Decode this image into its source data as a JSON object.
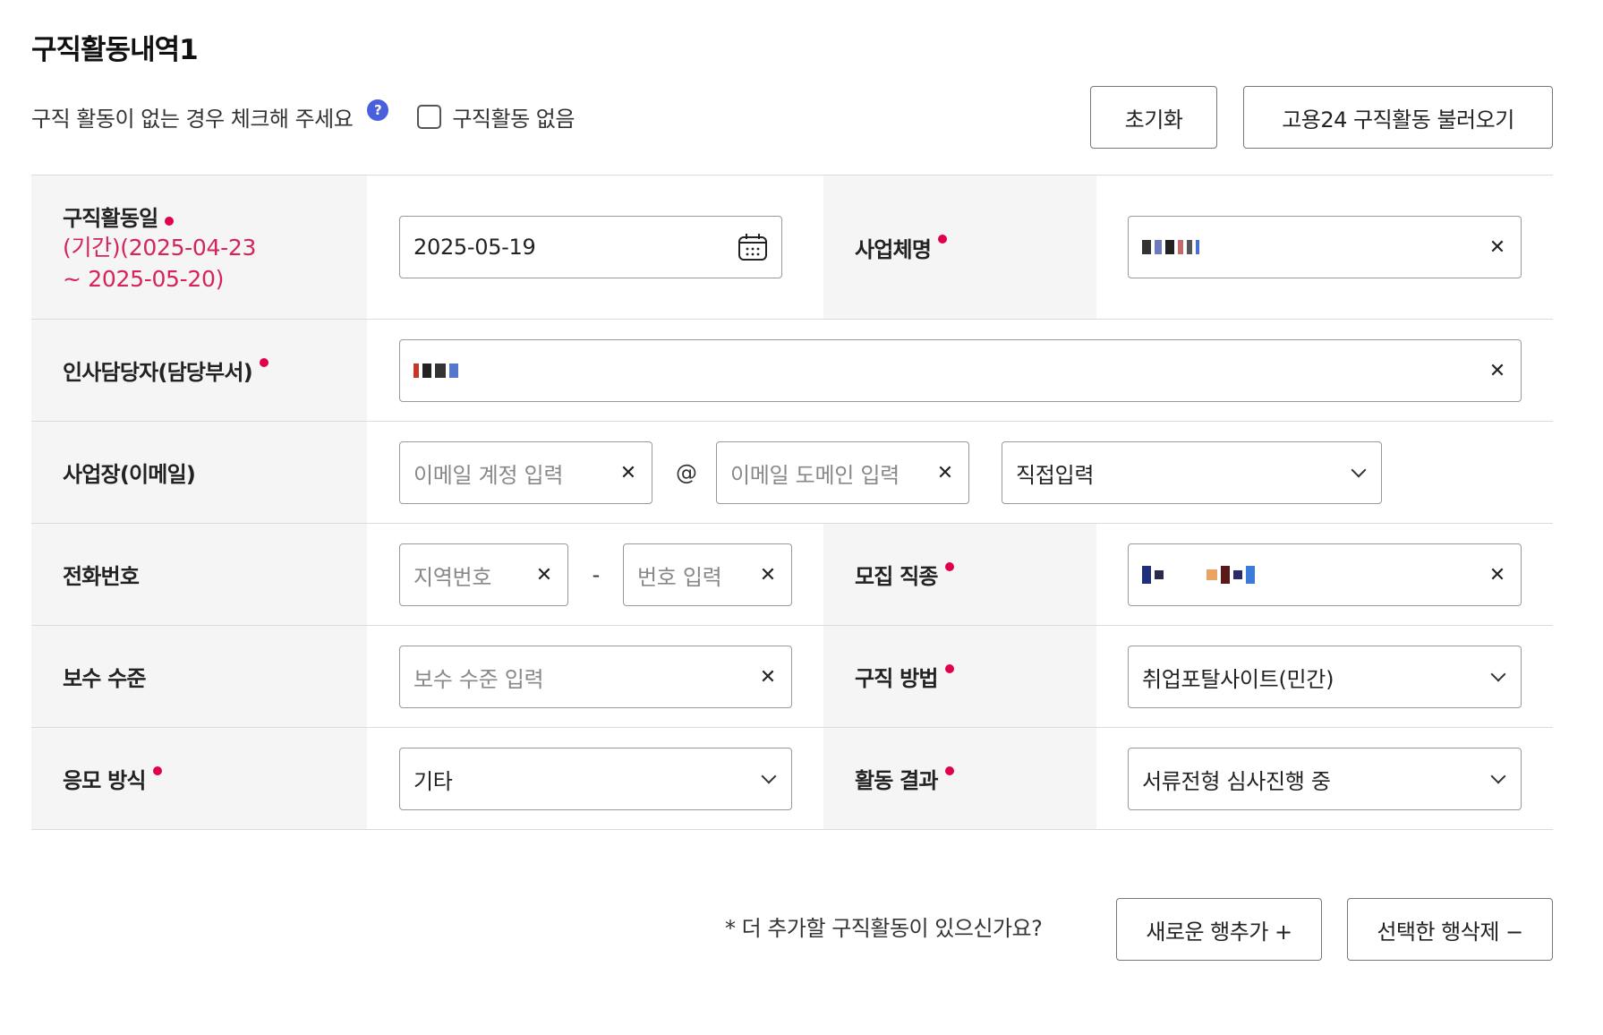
{
  "section": {
    "title": "구직활동내역1",
    "note": "구직 활동이 없는 경우 체크해 주세요",
    "help_icon": "?",
    "no_activity_label": "구직활동 없음",
    "reset_label": "초기화",
    "import_label": "고용24 구직활동 불러오기"
  },
  "form": {
    "activity_date": {
      "label": "구직활동일",
      "period_line1": "(기간)(2025-04-23",
      "period_line2": "~ 2025-05-20)",
      "value": "2025-05-19"
    },
    "company_name": {
      "label": "사업체명"
    },
    "hr_manager": {
      "label": "인사담당자(담당부서)"
    },
    "email": {
      "label": "사업장(이메일)",
      "account_placeholder": "이메일 계정 입력",
      "at": "@",
      "domain_placeholder": "이메일 도메인 입력",
      "domain_select": "직접입력"
    },
    "phone": {
      "label": "전화번호",
      "area_placeholder": "지역번호",
      "dash": "-",
      "number_placeholder": "번호 입력"
    },
    "job_type": {
      "label": "모집 직종"
    },
    "salary": {
      "label": "보수 수준",
      "placeholder": "보수 수준 입력"
    },
    "search_method": {
      "label": "구직 방법",
      "value": "취업포탈사이트(민간)"
    },
    "apply_method": {
      "label": "응모 방식",
      "value": "기타"
    },
    "result": {
      "label": "활동 결과",
      "value": "서류전형 심사진행 중"
    },
    "clear_glyph": "✕"
  },
  "footer": {
    "note": "* 더 추가할 구직활동이 있으신가요?",
    "add_label": "새로운 행추가 +",
    "delete_label": "선택한 행삭제 −"
  },
  "colors": {
    "required": "#e0004d",
    "period": "#d6245a",
    "help": "#4a5fdc",
    "label_bg": "#f5f5f5"
  }
}
